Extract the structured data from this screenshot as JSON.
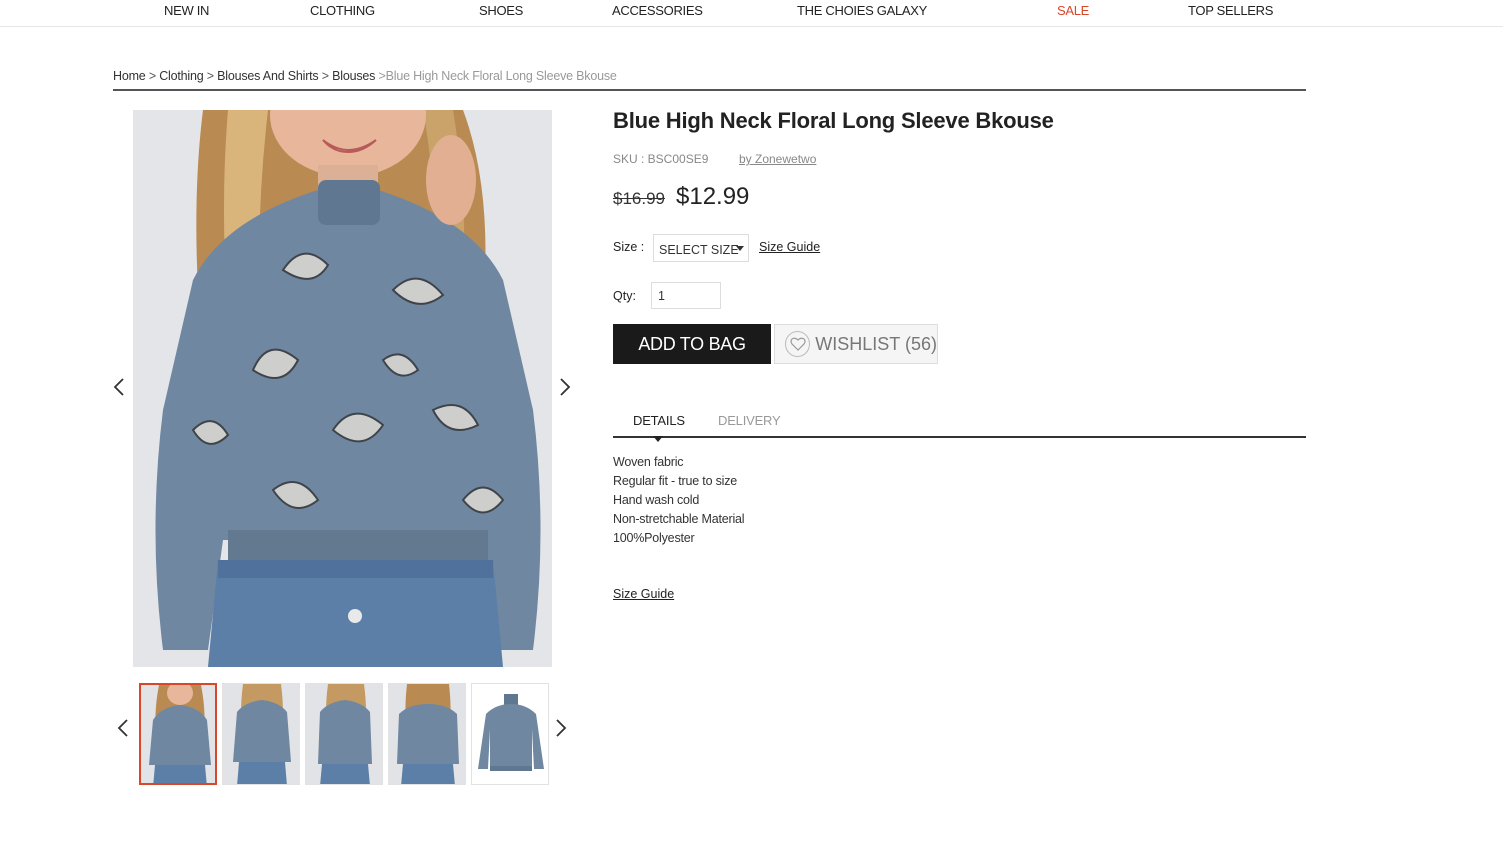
{
  "nav": {
    "items": [
      "NEW IN",
      "CLOTHING",
      "SHOES",
      "ACCESSORIES",
      "THE CHOIES GALAXY",
      "SALE",
      "TOP SELLERS"
    ]
  },
  "breadcrumb": {
    "items": [
      "Home",
      "Clothing",
      "Blouses And Shirts",
      "Blouses"
    ],
    "separator": ">",
    "current": ">Blue High Neck Floral Long Sleeve Bkouse"
  },
  "product": {
    "title": "Blue High Neck Floral Long Sleeve Bkouse",
    "sku": "SKU : BSC00SE9",
    "brand": "by Zonewetwo",
    "old_price": "$16.99",
    "new_price": "$12.99",
    "size_label": "Size :",
    "size_select": "SELECT SIZE",
    "size_guide": "Size Guide",
    "qty_label": "Qty:",
    "qty_value": "1",
    "add_to_bag": "ADD TO BAG",
    "wishlist": "WISHLIST (56)"
  },
  "tabs": [
    "DETAILS",
    "DELIVERY"
  ],
  "details": [
    "Woven fabric",
    "Regular fit - true to size",
    "Hand wash cold",
    "Non-stretchable Material",
    "100%Polyester"
  ],
  "size_guide_bottom": "Size Guide",
  "colors": {
    "accent_sale": "#d9472b",
    "button_dark": "#1a1a1a",
    "blouse_blue": "#6f87a0"
  },
  "icons": {
    "gallery_prev": "chevron-left-icon",
    "gallery_next": "chevron-right-icon",
    "wishlist": "heart-icon"
  }
}
